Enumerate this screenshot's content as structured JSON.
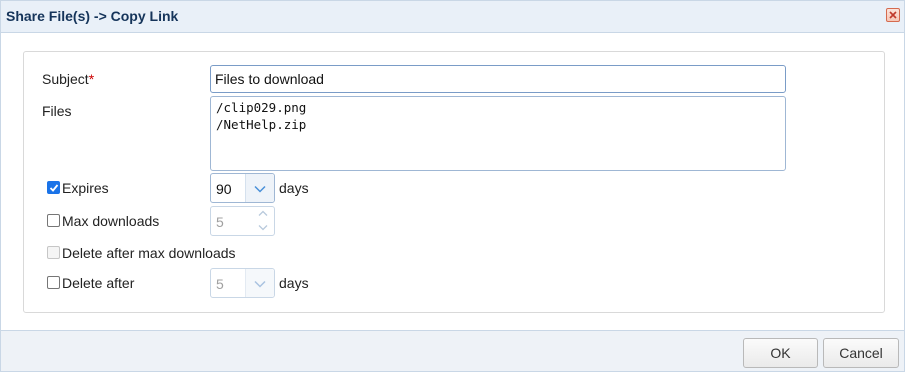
{
  "window": {
    "title": "Share File(s) -> Copy Link",
    "close_icon": "close-icon"
  },
  "form": {
    "subject": {
      "label": "Subject",
      "required_mark": "*",
      "value": "Files to download"
    },
    "files": {
      "label": "Files",
      "lines": [
        "/clip029.png",
        "/NetHelp.zip"
      ]
    },
    "expires": {
      "label": "Expires",
      "checked": true,
      "value": "90",
      "unit": "days"
    },
    "max_downloads": {
      "label": "Max downloads",
      "checked": false,
      "value": "5"
    },
    "delete_after_max": {
      "label": "Delete after max downloads",
      "checked": false,
      "disabled": true
    },
    "delete_after": {
      "label": "Delete after",
      "checked": false,
      "value": "5",
      "unit": "days"
    }
  },
  "footer": {
    "ok_label": "OK",
    "cancel_label": "Cancel"
  },
  "colors": {
    "accent": "#1a73e8",
    "title_text": "#15345a",
    "required": "#cc0000"
  }
}
